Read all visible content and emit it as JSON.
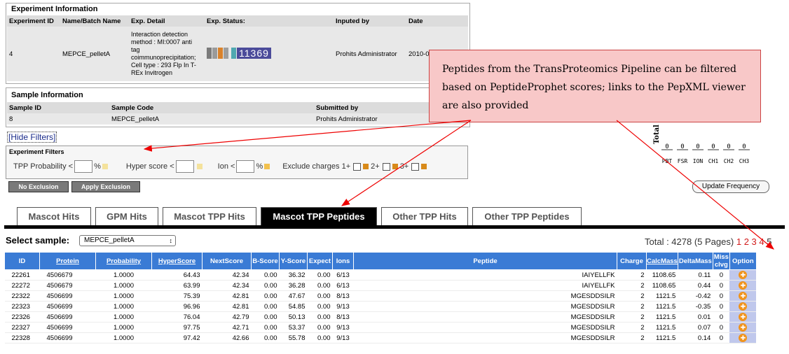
{
  "experiment_info": {
    "title": "Experiment Information",
    "headers": [
      "Experiment ID",
      "Name/Batch Name",
      "Exp. Detail",
      "Exp. Status:",
      "Inputed by",
      "Date"
    ],
    "row": {
      "id": "4",
      "name": "MEPCE_pelletA",
      "detail": "Interaction detection method : MI:0007 anti tag coimmunoprecipitation; Cell type : 293 Flp In T-REx Invitrogen",
      "status_number": "11369",
      "status_colors": [
        "#7b7b7b",
        "#9a9a9a",
        "#d9822b",
        "#9e9e9e",
        "#4fa8b0",
        "#6f6fae"
      ],
      "inputed_by": "Prohits Administrator",
      "date": "2010-01-"
    }
  },
  "sample_info": {
    "title": "Sample Information",
    "headers": [
      "Sample ID",
      "Sample Code",
      "Submitted by"
    ],
    "row": {
      "id": "8",
      "code": "MEPCE_pelletA",
      "submitted_by": "Prohits Administrator"
    }
  },
  "hide_filters": "[Hide Filters]",
  "filters": {
    "title": "Experiment Filters",
    "tpp_label": "TPP Probability <",
    "pct": "%",
    "hyper_label": "Hyper score <",
    "ion_label": "Ion <",
    "exclude_label": "Exclude charges 1+",
    "c2": "2+",
    "c3": "3+"
  },
  "buttons": {
    "no_exclusion": "No Exclusion",
    "apply_exclusion": "Apply Exclusion",
    "update_frequency": "Update Frequency"
  },
  "callout": "Peptides from the TransProteomics Pipeline can be filtered based on PeptideProphet scores; links to the PepXML viewer are also provided",
  "mini_chart": {
    "ylabel": "Total",
    "categories": [
      "PBT",
      "FSR",
      "ION",
      "CH1",
      "CH2",
      "CH3"
    ],
    "values": [
      "0",
      "0",
      "0",
      "0",
      "0",
      "0"
    ]
  },
  "tabs": [
    "Mascot Hits",
    "GPM Hits",
    "Mascot TPP Hits",
    "Mascot TPP Peptides",
    "Other TPP Hits",
    "Other TPP Peptides"
  ],
  "active_tab": 3,
  "select_sample": {
    "label": "Select sample:",
    "value": "MEPCE_pelletA"
  },
  "total": {
    "text": "Total : 4278 (5 Pages)",
    "pages": [
      "1",
      "2",
      "3",
      "4",
      "5"
    ]
  },
  "table": {
    "columns": [
      "ID",
      "Protein",
      "Probability",
      "HyperScore",
      "NextScore",
      "B-Score",
      "Y-Score",
      "Expect",
      "Ions",
      "Peptide",
      "Charge",
      "CalcMass",
      "DeltaMass",
      "Miss clvg",
      "Option"
    ],
    "underlined": [
      1,
      2,
      3,
      11
    ],
    "rows": [
      [
        "22261",
        "4506679",
        "1.0000",
        "64.43",
        "42.34",
        "0.00",
        "36.32",
        "0.00",
        "6/13",
        "IAIYELLFK",
        "2",
        "1108.65",
        "0.11",
        "0"
      ],
      [
        "22272",
        "4506679",
        "1.0000",
        "63.99",
        "42.34",
        "0.00",
        "36.28",
        "0.00",
        "6/13",
        "IAIYELLFK",
        "2",
        "1108.65",
        "0.44",
        "0"
      ],
      [
        "22322",
        "4506699",
        "1.0000",
        "75.39",
        "42.81",
        "0.00",
        "47.67",
        "0.00",
        "8/13",
        "MGESDDSILR",
        "2",
        "1121.5",
        "-0.42",
        "0"
      ],
      [
        "22323",
        "4506699",
        "1.0000",
        "96.96",
        "42.81",
        "0.00",
        "54.85",
        "0.00",
        "9/13",
        "MGESDDSILR",
        "2",
        "1121.5",
        "-0.35",
        "0"
      ],
      [
        "22326",
        "4506699",
        "1.0000",
        "76.04",
        "42.79",
        "0.00",
        "50.13",
        "0.00",
        "8/13",
        "MGESDDSILR",
        "2",
        "1121.5",
        "0.01",
        "0"
      ],
      [
        "22327",
        "4506699",
        "1.0000",
        "97.75",
        "42.71",
        "0.00",
        "53.37",
        "0.00",
        "9/13",
        "MGESDDSILR",
        "2",
        "1121.5",
        "0.07",
        "0"
      ],
      [
        "22328",
        "4506699",
        "1.0000",
        "97.42",
        "42.66",
        "0.00",
        "55.78",
        "0.00",
        "9/13",
        "MGESDDSILR",
        "2",
        "1121.5",
        "0.14",
        "0"
      ]
    ]
  }
}
